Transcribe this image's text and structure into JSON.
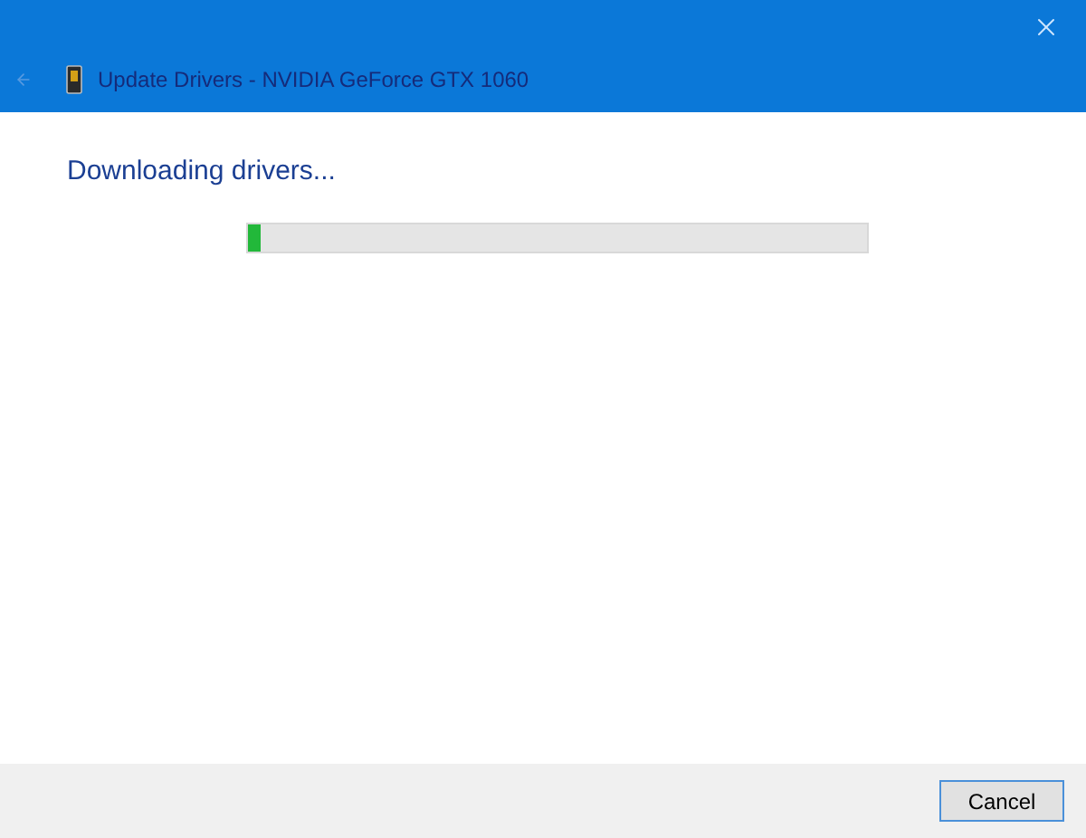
{
  "window": {
    "title": "Update Drivers - NVIDIA GeForce GTX 1060",
    "back_disabled": true
  },
  "heading": "Downloading drivers...",
  "progress": {
    "level": 0.02
  },
  "buttons": [
    {
      "label": "Cancel"
    }
  ]
}
